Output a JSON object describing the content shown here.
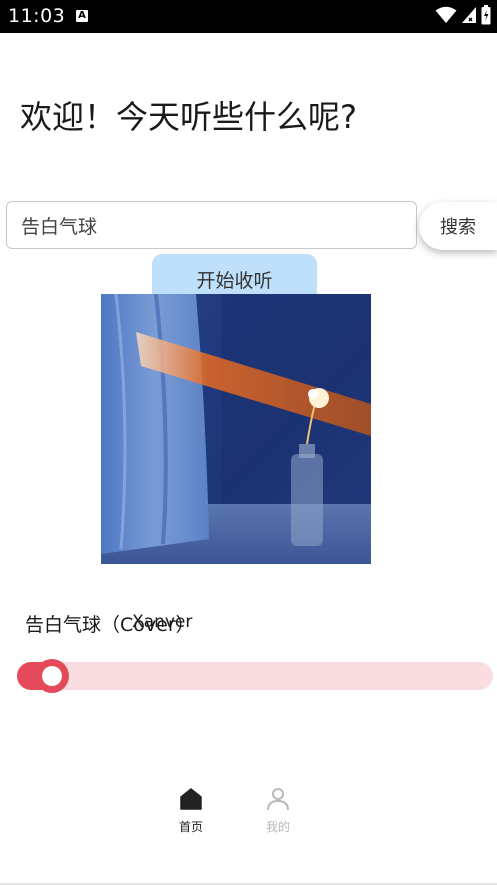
{
  "status_bar": {
    "time": "11:03",
    "a_icon": "A",
    "icons": [
      "wifi-icon",
      "signal-icon",
      "battery-icon"
    ]
  },
  "welcome": "欢迎！今天听些什么呢?",
  "search": {
    "value": "告白气球",
    "button_label": "搜索"
  },
  "start_button_label": "开始收听",
  "cover_art": "song-cover-image",
  "song": {
    "title": "告白气球（Cover）",
    "artist": "Xanver"
  },
  "progress": {
    "fraction": 0.04
  },
  "bottom_nav": {
    "items": [
      {
        "label": "首页",
        "icon": "home-icon",
        "active": true
      },
      {
        "label": "我的",
        "icon": "profile-icon",
        "active": false
      }
    ]
  },
  "colors": {
    "accent": "#e54a5a",
    "track": "#fadde1",
    "start_button_bg": "#bfe0fa"
  }
}
